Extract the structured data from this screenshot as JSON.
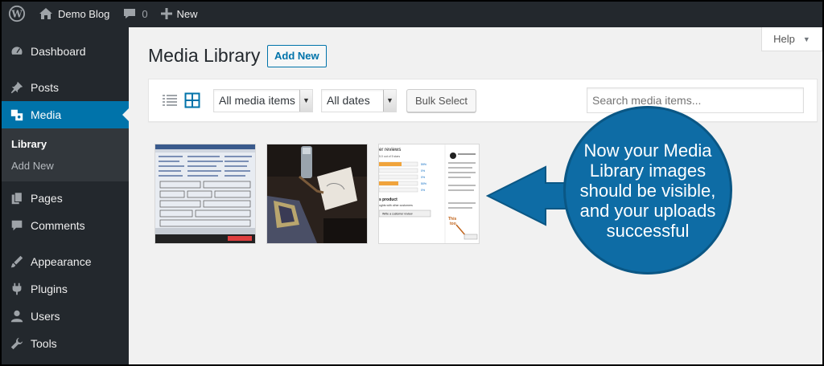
{
  "admin_bar": {
    "site_name": "Demo Blog",
    "comments_count": "0",
    "new_label": "New"
  },
  "sidebar": {
    "items": [
      {
        "label": "Dashboard",
        "icon": "dashboard-icon"
      },
      {
        "label": "Posts",
        "icon": "pin-icon"
      },
      {
        "label": "Media",
        "icon": "media-icon",
        "active": true
      },
      {
        "label": "Pages",
        "icon": "pages-icon"
      },
      {
        "label": "Comments",
        "icon": "comment-icon"
      },
      {
        "label": "Appearance",
        "icon": "brush-icon"
      },
      {
        "label": "Plugins",
        "icon": "plugin-icon"
      },
      {
        "label": "Users",
        "icon": "user-icon"
      },
      {
        "label": "Tools",
        "icon": "wrench-icon"
      }
    ],
    "media_submenu": [
      "Library",
      "Add New"
    ]
  },
  "help_label": "Help",
  "page_title": "Media Library",
  "add_new_label": "Add New",
  "toolbar": {
    "type_filter": "All media items",
    "date_filter": "All dates",
    "bulk_select_label": "Bulk Select",
    "search_placeholder": "Search media items..."
  },
  "thumbnails": [
    {
      "name": "screenshot-form"
    },
    {
      "name": "photo-table"
    },
    {
      "name": "customer-reviews",
      "texts": [
        "er reviews",
        "5.0 out of 5 stars",
        "59%",
        "0%",
        "0%",
        "50%",
        "0%",
        "s product",
        "ughts with other customers",
        "Write a customer review",
        "This",
        "too"
      ]
    }
  ],
  "callout": {
    "text": "Now your Media Library images should be visible, and your uploads successful"
  },
  "colors": {
    "admin_bar": "#23282d",
    "accent": "#0073aa",
    "callout": "#0e6ca5"
  }
}
